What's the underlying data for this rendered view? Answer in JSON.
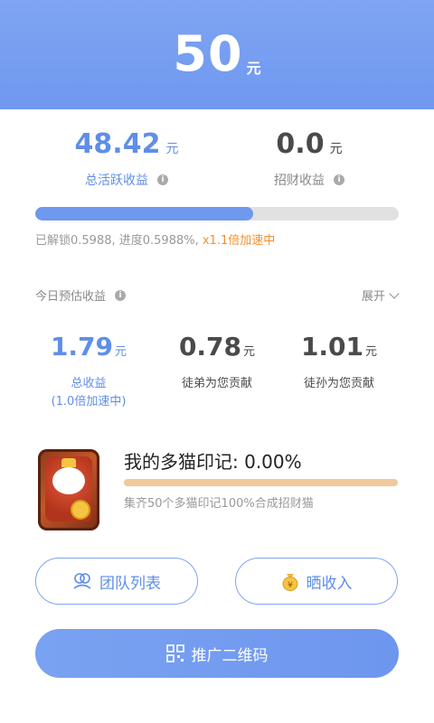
{
  "header": {
    "amount": "50",
    "unit": "元"
  },
  "earnings": {
    "active": {
      "value": "48.42",
      "unit": "元",
      "label": "总活跃收益"
    },
    "fortune": {
      "value": "0.0",
      "unit": "元",
      "label": "招财收益"
    }
  },
  "progress": {
    "fraction": 0.5988,
    "text": "已解锁0.5988, 进度0.5988%, ",
    "speed_text": "x1.1倍加速中"
  },
  "today": {
    "title": "今日预估收益",
    "expand_label": "展开",
    "stats": [
      {
        "value": "1.79",
        "unit": "元",
        "label": "总收益",
        "sub": "(1.0倍加速中)"
      },
      {
        "value": "0.78",
        "unit": "元",
        "label": "徒弟为您贡献"
      },
      {
        "value": "1.01",
        "unit": "元",
        "label": "徒孙为您贡献"
      }
    ]
  },
  "cat": {
    "title": "我的多猫印记: 0.00%",
    "description": "集齐50个多猫印记100%合成招财猫"
  },
  "buttons": {
    "team_list": "团队列表",
    "show_income": "晒收入",
    "qr_code": "推广二维码"
  },
  "colors": {
    "accent": "#6f98ef",
    "speed": "#f2902f",
    "cat_bar": "#f1c89a"
  }
}
